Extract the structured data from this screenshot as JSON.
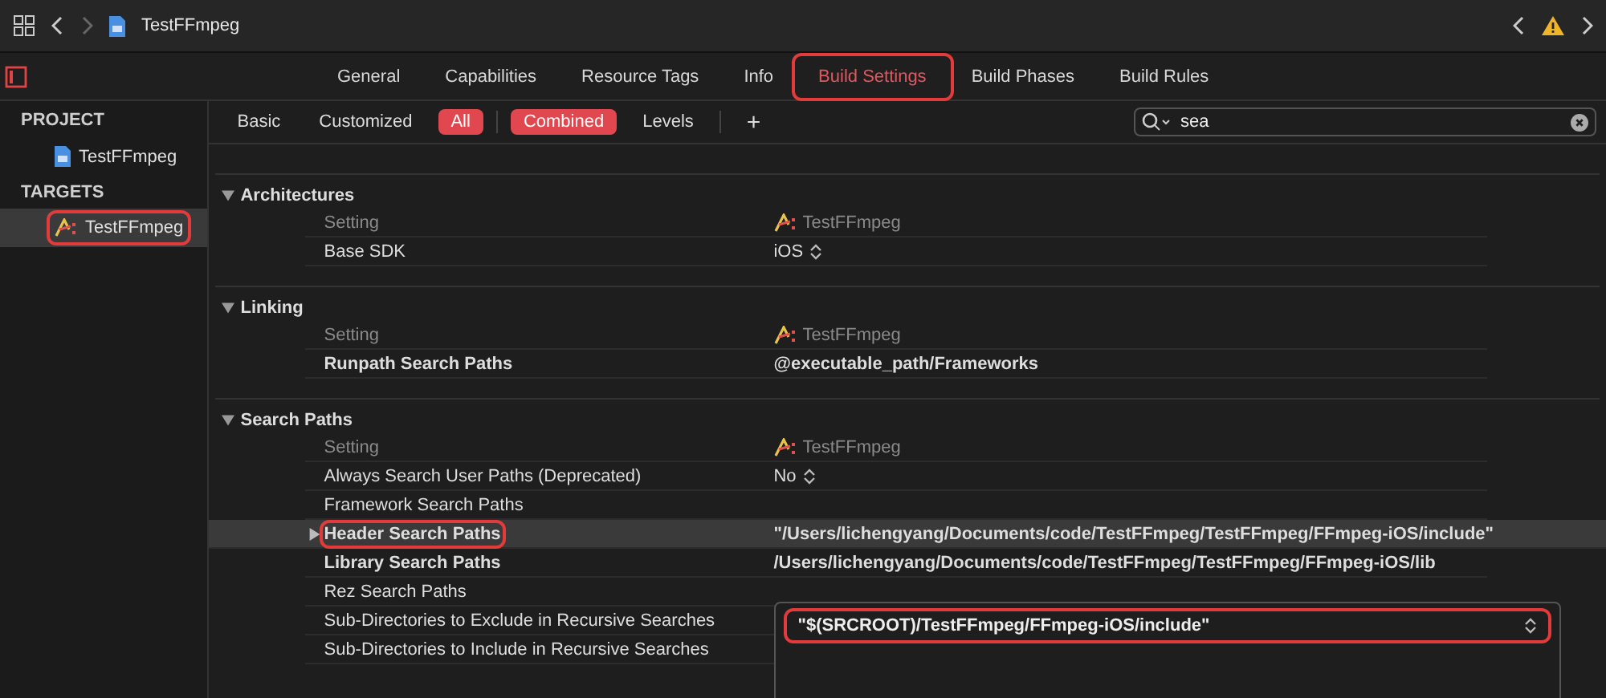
{
  "toolbar": {
    "title": "TestFFmpeg"
  },
  "tabs": [
    {
      "label": "General",
      "selected": false,
      "annotated": false
    },
    {
      "label": "Capabilities",
      "selected": false,
      "annotated": false
    },
    {
      "label": "Resource Tags",
      "selected": false,
      "annotated": false
    },
    {
      "label": "Info",
      "selected": false,
      "annotated": false
    },
    {
      "label": "Build Settings",
      "selected": true,
      "annotated": true
    },
    {
      "label": "Build Phases",
      "selected": false,
      "annotated": false
    },
    {
      "label": "Build Rules",
      "selected": false,
      "annotated": false
    }
  ],
  "sidebar": {
    "sections": [
      {
        "title": "PROJECT",
        "items": [
          {
            "label": "TestFFmpeg",
            "kind": "project",
            "selected": false,
            "annotated": false
          }
        ]
      },
      {
        "title": "TARGETS",
        "items": [
          {
            "label": "TestFFmpeg",
            "kind": "target",
            "selected": true,
            "annotated": true
          }
        ]
      }
    ]
  },
  "filters": [
    {
      "label": "Basic",
      "selected": false
    },
    {
      "label": "Customized",
      "selected": false
    },
    {
      "label": "All",
      "selected": true
    }
  ],
  "views": [
    {
      "label": "Combined",
      "selected": true
    },
    {
      "label": "Levels",
      "selected": false
    }
  ],
  "add_button": "+",
  "search": {
    "value": "sea"
  },
  "sections": [
    {
      "title": "Architectures",
      "expanded": true,
      "column_header": "Setting",
      "target": "TestFFmpeg",
      "rows": [
        {
          "label": "Base SDK",
          "value": "iOS",
          "bold": false,
          "popup": true,
          "selected": false,
          "expandable": false,
          "annotated": false
        }
      ]
    },
    {
      "title": "Linking",
      "expanded": true,
      "column_header": "Setting",
      "target": "TestFFmpeg",
      "rows": [
        {
          "label": "Runpath Search Paths",
          "value": "@executable_path/Frameworks",
          "bold": true,
          "popup": false,
          "selected": false,
          "expandable": false,
          "annotated": false
        }
      ]
    },
    {
      "title": "Search Paths",
      "expanded": true,
      "column_header": "Setting",
      "target": "TestFFmpeg",
      "rows": [
        {
          "label": "Always Search User Paths (Deprecated)",
          "value": "No",
          "bold": false,
          "popup": true,
          "selected": false,
          "expandable": false,
          "annotated": false
        },
        {
          "label": "Framework Search Paths",
          "bold": false,
          "popup": false,
          "selected": false,
          "expandable": false,
          "annotated": false
        },
        {
          "label": "Header Search Paths",
          "value": "\"/Users/lichengyang/Documents/code/TestFFmpeg/TestFFmpeg/FFmpeg-iOS/include\"",
          "bold": true,
          "popup": false,
          "selected": true,
          "expandable": true,
          "annotated": true
        },
        {
          "label": "Library Search Paths",
          "value": "/Users/lichengyang/Documents/code/TestFFmpeg/TestFFmpeg/FFmpeg-iOS/lib",
          "bold": true,
          "popup": false,
          "selected": false,
          "expandable": false,
          "annotated": false
        },
        {
          "label": "Rez Search Paths",
          "bold": false,
          "popup": false,
          "selected": false,
          "expandable": false,
          "annotated": false
        },
        {
          "label": "Sub-Directories to Exclude in Recursive Searches",
          "bold": false,
          "popup": false,
          "selected": false,
          "expandable": false,
          "annotated": false
        },
        {
          "label": "Sub-Directories to Include in Recursive Searches",
          "bold": false,
          "popup": false,
          "selected": false,
          "expandable": false,
          "annotated": false
        }
      ]
    }
  ],
  "editor_popup": {
    "value": "\"$(SRCROOT)/TestFFmpeg/FFmpeg-iOS/include\"",
    "annotated": true
  }
}
